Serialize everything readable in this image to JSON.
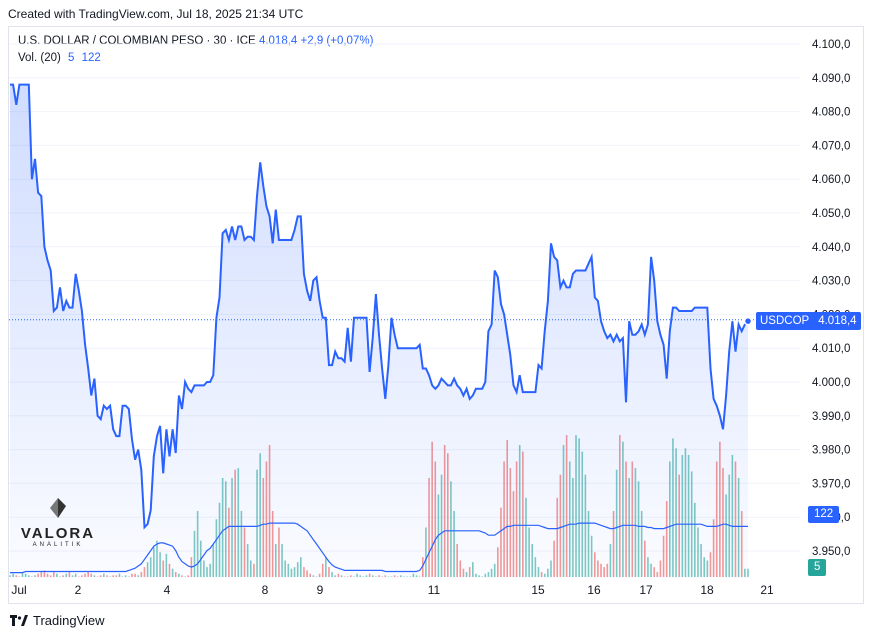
{
  "header": {
    "created_with": "Created with TradingView.com, Jul 18, 2025 21:34 UTC"
  },
  "legend": {
    "symbol": "U.S. DOLLAR / COLOMBIAN PESO · 30 · ICE",
    "last": "4.018,4",
    "change": "+2,9 (+0,07%)",
    "vol_label": "Vol. (20)",
    "vol_value": "5",
    "vol_ma": "122"
  },
  "price_tag": {
    "symbol": "USDCOP",
    "value": "4.018,4"
  },
  "volume_tags": {
    "ma": "122",
    "last": "5"
  },
  "watermark": {
    "name": "VALORA",
    "sub": "ANALITIK"
  },
  "footer": {
    "brand": "TradingView"
  },
  "colors": {
    "line": "#2962ff",
    "vol_up": "#26a69a",
    "vol_down": "#ef5350",
    "price_tag": "#2962ff"
  },
  "chart_data": {
    "type": "area",
    "series": [
      {
        "name": "USDCOP",
        "color": "#2962ff"
      }
    ],
    "y_ticks": [
      3950,
      3960,
      3970,
      3980,
      3990,
      4000,
      4010,
      4020,
      4030,
      4040,
      4050,
      4060,
      4070,
      4080,
      4090,
      4100
    ],
    "y_tick_labels": [
      "3.950,0",
      "3.960,0",
      "3.970,0",
      "3.980,0",
      "3.990,0",
      "4.000,0",
      "4.010,0",
      "4.020,0",
      "4.030,0",
      "4.040,0",
      "4.050,0",
      "4.060,0",
      "4.070,0",
      "4.080,0",
      "4.090,0",
      "4.100,0"
    ],
    "x_tick_labels": [
      "Jul",
      "2",
      "4",
      "8",
      "9",
      "11",
      "15",
      "16",
      "17",
      "18",
      "21"
    ],
    "ylim": [
      3944,
      4104
    ],
    "last_value": 4018.4,
    "price": [
      4088,
      4088,
      4082,
      4088,
      4088,
      4088,
      4088,
      4060,
      4066,
      4056,
      4055,
      4040,
      4036,
      4033,
      4021,
      4022,
      4028,
      4021,
      4024,
      4022,
      4022,
      4032,
      4027,
      4021,
      4011,
      4004,
      3996,
      4001,
      3990,
      3989,
      3993,
      3992,
      3993,
      3986,
      3984,
      3984,
      3993,
      3993,
      3992,
      3983,
      3977,
      3980,
      3974,
      3957,
      3958,
      3962,
      3978,
      3984,
      3987,
      3973,
      3986,
      3978,
      3986,
      3979,
      3996,
      3992,
      4000,
      3998,
      3997,
      3999,
      3999,
      3999,
      3999,
      4000,
      4000,
      4002,
      4019,
      4025,
      4044,
      4045,
      4042,
      4046,
      4042,
      4046,
      4046,
      4042,
      4043,
      4043,
      4042,
      4055,
      4065,
      4058,
      4052,
      4049,
      4041,
      4051,
      4042,
      4042,
      4042,
      4042,
      4042,
      4045,
      4049,
      4049,
      4032,
      4027,
      4024,
      4030,
      4031,
      4024,
      4019,
      4019,
      4005,
      4005,
      4009,
      4007,
      4007,
      4006,
      4016,
      4006,
      4019,
      4019,
      4019,
      4019,
      4019,
      4003,
      4013,
      4026,
      4014,
      4004,
      3995,
      4005,
      4019,
      4014,
      4010,
      4010,
      4010,
      4010,
      4010,
      4010,
      4010,
      4011,
      4004,
      4004,
      4002,
      3999,
      3998,
      3999,
      4001,
      4000,
      3999,
      3999,
      4001,
      3999,
      3998,
      3996,
      3998,
      3995,
      3996,
      3998,
      3998,
      3998,
      4000,
      4015,
      4017,
      4033,
      4031,
      4023,
      4020,
      4014,
      4008,
      3999,
      3997,
      4002,
      3997,
      3997,
      3997,
      3997,
      3997,
      4005,
      4004,
      4015,
      4024,
      4041,
      4037,
      4036,
      4028,
      4030,
      4028,
      4028,
      4032,
      4033,
      4033,
      4033,
      4033,
      4035,
      4037,
      4025,
      4024,
      4018,
      4015,
      4013,
      4014,
      4012,
      4014,
      4012,
      4013,
      3994,
      4018,
      4014,
      4014,
      4015,
      4017,
      4014,
      4017,
      4037,
      4030,
      4018,
      4014,
      4011,
      4001,
      4015,
      4022,
      4022,
      4021,
      4021,
      4021,
      4021,
      4021,
      4022,
      4022,
      4022,
      4022,
      4022,
      4004,
      3995,
      3993,
      3990,
      3986,
      3996,
      4009,
      4018,
      4009,
      4017,
      4015,
      4017,
      4018
    ],
    "volume": [
      1,
      2,
      1,
      0,
      3,
      2,
      1,
      0,
      1,
      2,
      3,
      4,
      2,
      1,
      3,
      2,
      0,
      1,
      2,
      3,
      1,
      2,
      0,
      1,
      2,
      3,
      2,
      1,
      0,
      1,
      2,
      1,
      0,
      1,
      1,
      2,
      0,
      1,
      0,
      2,
      2,
      1,
      3,
      6,
      9,
      12,
      18,
      22,
      15,
      10,
      14,
      8,
      5,
      3,
      2,
      1,
      0,
      1,
      12,
      28,
      40,
      22,
      10,
      6,
      8,
      20,
      35,
      45,
      60,
      58,
      42,
      60,
      65,
      66,
      40,
      30,
      20,
      10,
      8,
      65,
      75,
      60,
      70,
      80,
      40,
      20,
      30,
      20,
      10,
      8,
      5,
      6,
      9,
      12,
      6,
      4,
      2,
      1,
      0,
      2,
      8,
      12,
      6,
      3,
      1,
      2,
      1,
      0,
      0,
      1,
      0,
      2,
      1,
      0,
      1,
      2,
      1,
      0,
      1,
      0,
      1,
      0,
      0,
      1,
      0,
      1,
      0,
      0,
      0,
      2,
      1,
      0,
      12,
      30,
      60,
      82,
      70,
      50,
      62,
      80,
      75,
      58,
      40,
      20,
      10,
      5,
      3,
      6,
      9,
      2,
      1,
      0,
      2,
      3,
      5,
      8,
      18,
      42,
      70,
      83,
      66,
      52,
      70,
      80,
      76,
      48,
      30,
      20,
      12,
      6,
      3,
      2,
      5,
      10,
      22,
      48,
      62,
      80,
      86,
      70,
      60,
      86,
      84,
      76,
      62,
      40,
      25,
      15,
      10,
      8,
      6,
      8,
      20,
      40,
      65,
      86,
      82,
      70,
      60,
      70,
      66,
      58,
      40,
      22,
      12,
      8,
      6,
      3,
      10,
      25,
      46,
      70,
      84,
      78,
      62,
      74,
      78,
      74,
      64,
      45,
      30,
      20,
      12,
      10,
      15,
      35,
      70,
      82,
      66,
      50,
      62,
      74,
      70,
      60,
      40,
      5,
      5
    ],
    "volume_ma": [
      4,
      4,
      4,
      4,
      4,
      5,
      5,
      5,
      5,
      5,
      5,
      5,
      5,
      5,
      5,
      5,
      5,
      5,
      5,
      5,
      5,
      5,
      5,
      5,
      5,
      5,
      5,
      5,
      5,
      5,
      5,
      5,
      5,
      5,
      5,
      5,
      5,
      5,
      6,
      7,
      8,
      10,
      12,
      16,
      20,
      24,
      28,
      30,
      31,
      31,
      30,
      29,
      28,
      24,
      18,
      14,
      12,
      10,
      9,
      10,
      12,
      16,
      20,
      24,
      26,
      30,
      34,
      38,
      42,
      44,
      46,
      46,
      46,
      46,
      46,
      46,
      46,
      46,
      46,
      46,
      47,
      48,
      48,
      49,
      49,
      49,
      49,
      49,
      49,
      49,
      49,
      49,
      48,
      46,
      44,
      42,
      38,
      34,
      30,
      26,
      22,
      18,
      14,
      11,
      9,
      8,
      7,
      6,
      6,
      6,
      6,
      6,
      6,
      6,
      6,
      6,
      6,
      6,
      6,
      6,
      5,
      5,
      5,
      5,
      5,
      5,
      5,
      5,
      5,
      5,
      5,
      6,
      10,
      16,
      22,
      28,
      34,
      38,
      40,
      42,
      42,
      42,
      42,
      42,
      42,
      42,
      42,
      42,
      42,
      42,
      42,
      41,
      40,
      38,
      38,
      38,
      40,
      42,
      44,
      46,
      46,
      47,
      47,
      47,
      47,
      47,
      47,
      47,
      47,
      47,
      46,
      45,
      44,
      44,
      44,
      44,
      45,
      46,
      47,
      48,
      48,
      48,
      49,
      49,
      49,
      49,
      49,
      49,
      48,
      47,
      46,
      45,
      44,
      44,
      45,
      46,
      47,
      47,
      47,
      47,
      47,
      46,
      46,
      46,
      45,
      45,
      44,
      44,
      44,
      44,
      45,
      46,
      47,
      48,
      48,
      48,
      48,
      48,
      48,
      48,
      48,
      48,
      47,
      46,
      46,
      46,
      46,
      47,
      48,
      48,
      47,
      46,
      46,
      46,
      46,
      46,
      46,
      46
    ]
  }
}
